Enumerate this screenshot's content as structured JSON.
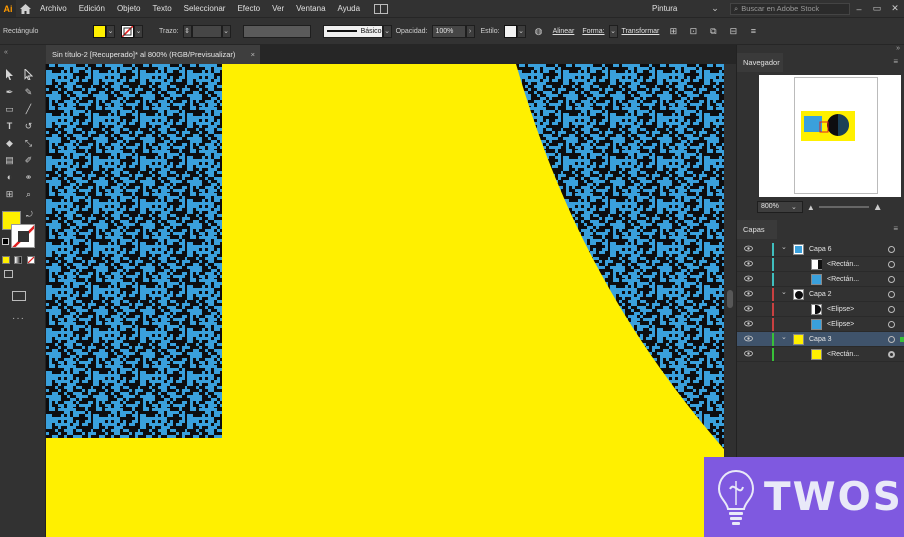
{
  "app": {
    "logo": "Ai"
  },
  "menu": [
    "Archivo",
    "Edición",
    "Objeto",
    "Texto",
    "Seleccionar",
    "Efecto",
    "Ver",
    "Ventana",
    "Ayuda"
  ],
  "workspace": "Pintura",
  "stock_search_placeholder": "Buscar en Adobe Stock",
  "control": {
    "selection_label": "Rectángulo",
    "stroke_label": "Trazo:",
    "brush_value": "Básico",
    "opacity_label": "Opacidad:",
    "opacity_value": "100%",
    "style_label": "Estilo:",
    "align_label": "Alinear",
    "shape_label": "Forma:",
    "transform_label": "Transformar",
    "fill_color": "#fff000"
  },
  "document": {
    "tab_title": "Sin título-2 [Recuperado]* al 800% (RGB/Previsualizar)",
    "close": "×"
  },
  "navigator": {
    "title": "Navegador",
    "zoom": "800%"
  },
  "layers": {
    "title": "Capas",
    "rows": [
      {
        "name": "Capa 6",
        "color": "#3fbfbf",
        "thumb": "blue"
      },
      {
        "name": "<Rectán...",
        "color": "#3fbfbf",
        "thumb": "white"
      },
      {
        "name": "<Rectán...",
        "color": "#3fbfbf",
        "thumb": "blue"
      },
      {
        "name": "Capa 2",
        "color": "#c94040",
        "thumb": "circle"
      },
      {
        "name": "<Elipse>",
        "color": "#c94040",
        "thumb": "circle-half"
      },
      {
        "name": "<Elipse>",
        "color": "#c94040",
        "thumb": "blue"
      },
      {
        "name": "Capa 3",
        "color": "#38c038",
        "thumb": "yellow"
      },
      {
        "name": "<Rectán...",
        "color": "#38c038",
        "thumb": "yellow"
      }
    ]
  },
  "colors": {
    "yellow": "#fff000",
    "dark": "#0d0d0f",
    "speckle": "#3aa0dc",
    "accent_purple": "#7f59e0"
  },
  "watermark": {
    "text": "TWOS"
  }
}
